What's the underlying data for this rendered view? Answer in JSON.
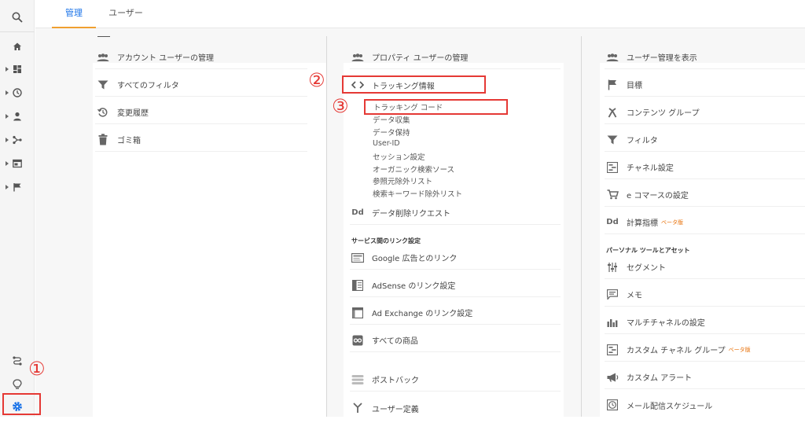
{
  "tabs": {
    "admin": "管理",
    "users": "ユーザー"
  },
  "account": {
    "items": [
      {
        "label": "アカウント ユーザーの管理",
        "icon": "users-icon"
      },
      {
        "label": "すべてのフィルタ",
        "icon": "filter-icon"
      },
      {
        "label": "変更履歴",
        "icon": "history-icon"
      },
      {
        "label": "ゴミ箱",
        "icon": "trash-icon"
      }
    ]
  },
  "property": {
    "users": "プロパティ ユーザーの管理",
    "tracking": "トラッキング情報",
    "tracking_sub": [
      "トラッキング コード",
      "データ収集",
      "データ保持",
      "User-ID",
      "セッション設定",
      "オーガニック検索ソース",
      "参照元除外リスト",
      "検索キーワード除外リスト"
    ],
    "data_deletion": "データ削除リクエスト",
    "dd_icon": "Dd",
    "linking_section": "サービス間のリンク設定",
    "links": [
      {
        "label": "Google 広告とのリンク",
        "icon": "google-ads-icon"
      },
      {
        "label": "AdSense のリンク設定",
        "icon": "adsense-icon"
      },
      {
        "label": "Ad Exchange のリンク設定",
        "icon": "ad-exchange-icon"
      },
      {
        "label": "すべての商品",
        "icon": "all-products-icon"
      }
    ],
    "postbacks": "ポストバック",
    "user_definitions": "ユーザー定義"
  },
  "view": {
    "items": [
      {
        "label": "ユーザー管理を表示",
        "icon": "users-icon"
      },
      {
        "label": "目標",
        "icon": "flag-icon"
      },
      {
        "label": "コンテンツ グループ",
        "icon": "content-group-icon"
      },
      {
        "label": "フィルタ",
        "icon": "filter-icon"
      },
      {
        "label": "チャネル設定",
        "icon": "channel-icon"
      },
      {
        "label": "e コマースの設定",
        "icon": "cart-icon"
      },
      {
        "label": "計算指標",
        "icon": "dd-icon",
        "beta": "ベータ版"
      }
    ],
    "personal_section": "パーソナル ツールとアセット",
    "personal": [
      {
        "label": "セグメント",
        "icon": "segment-icon"
      },
      {
        "label": "メモ",
        "icon": "memo-icon"
      },
      {
        "label": "マルチチャネルの設定",
        "icon": "bar-chart-icon"
      },
      {
        "label": "カスタム チャネル グループ",
        "icon": "custom-channel-icon",
        "beta": "ベータ版"
      },
      {
        "label": "カスタム アラート",
        "icon": "megaphone-icon"
      },
      {
        "label": "メール配信スケジュール",
        "icon": "clock-icon"
      }
    ]
  },
  "annotations": {
    "one": "①",
    "two": "②",
    "three": "③"
  },
  "colors": {
    "accent": "#1a73e8",
    "tab_underline": "#f0a030",
    "callout": "#e53935",
    "beta": "#e8710a"
  }
}
